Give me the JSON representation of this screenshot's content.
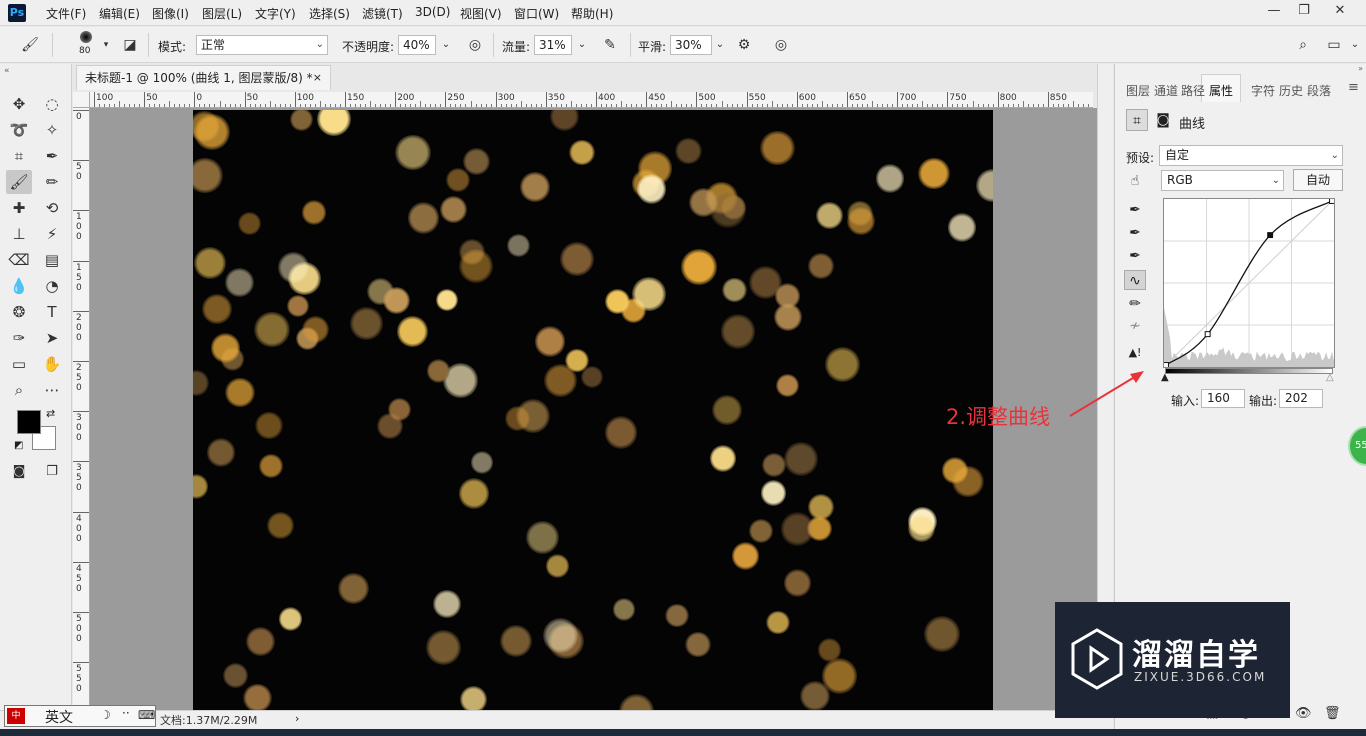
{
  "app": {
    "logo": "Ps"
  },
  "menu": [
    "文件(F)",
    "编辑(E)",
    "图像(I)",
    "图层(L)",
    "文字(Y)",
    "选择(S)",
    "滤镜(T)",
    "3D(D)",
    "视图(V)",
    "窗口(W)",
    "帮助(H)"
  ],
  "window_controls": {
    "minimize": "—",
    "restore": "❐",
    "close": "✕"
  },
  "options": {
    "brush_size": "80",
    "mode_label": "模式:",
    "mode_value": "正常",
    "opacity_label": "不透明度:",
    "opacity_value": "40%",
    "flow_label": "流量:",
    "flow_value": "31%",
    "smooth_label": "平滑:",
    "smooth_value": "30%"
  },
  "document": {
    "tab_title": "未标题-1 @ 100% (曲线 1, 图层蒙版/8) *",
    "close": "×"
  },
  "rulers": {
    "h_ticks": [
      "100",
      "50",
      "0",
      "50",
      "100",
      "150",
      "200",
      "250",
      "300",
      "350",
      "400",
      "450",
      "500",
      "550",
      "600",
      "650",
      "700",
      "750",
      "800",
      "850"
    ],
    "v_ticks": [
      "0",
      "5 0",
      "1 0 0",
      "1 5 0",
      "2 0 0",
      "2 5 0",
      "3 0 0",
      "3 5 0",
      "4 0 0",
      "4 5 0",
      "5 0 0",
      "5 5 0"
    ]
  },
  "statusbar": {
    "ime_label": "英文",
    "doc_info": "文档:1.37M/2.29M",
    "doc_arrow": "›"
  },
  "panel": {
    "tabs": [
      "图层",
      "通道",
      "路径",
      "属性",
      "字符",
      "历史",
      "段落"
    ],
    "active_tab": "属性",
    "menu_icon": "≡",
    "title": "曲线",
    "preset_label": "预设:",
    "preset_value": "自定",
    "channel_value": "RGB",
    "auto_button": "自动",
    "input_label": "输入:",
    "input_value": "160",
    "output_label": "输出:",
    "output_value": "202"
  },
  "curve": {
    "control_points": [
      [
        0,
        0
      ],
      [
        64,
        48
      ],
      [
        160,
        202
      ],
      [
        255,
        255
      ]
    ]
  },
  "annotation": "2.调整曲线",
  "watermark": {
    "title": "溜溜自学",
    "url": "ZIXUE.3D66.COM"
  },
  "green_bubble": "55",
  "colors": {
    "canvas_bg": "#050404",
    "annotation": "#e8333b",
    "watermark_bg": "#1d2433",
    "ps_blue": "#31a8ff"
  }
}
